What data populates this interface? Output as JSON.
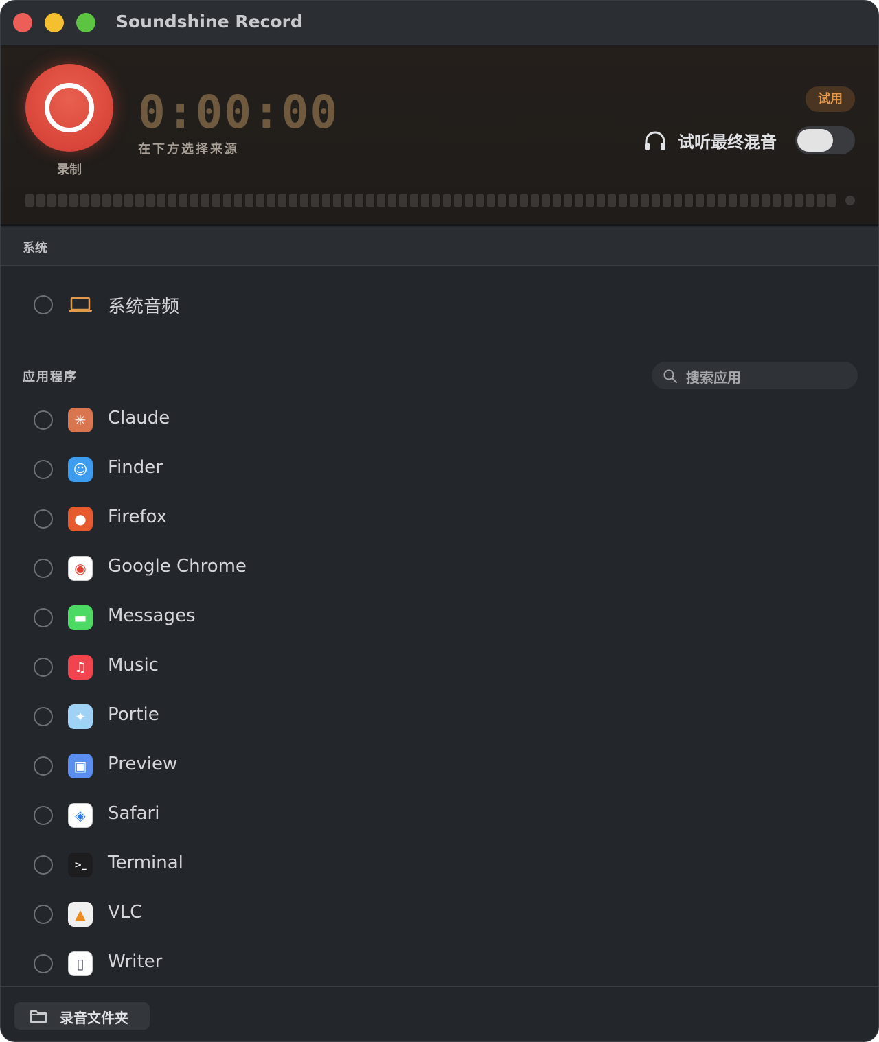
{
  "window": {
    "title": "Soundshine Record"
  },
  "recorder": {
    "record_label": "录制",
    "timer": "0:00:00",
    "timer_hint": "在下方选择来源",
    "trial_badge": "试用",
    "monitor_label": "试听最终混音",
    "monitor_enabled": false
  },
  "system": {
    "header": "系统",
    "source": {
      "label": "系统音频",
      "icon": "laptop-icon",
      "selected": false
    }
  },
  "apps": {
    "header": "应用程序",
    "search_placeholder": "搜索应用",
    "items": [
      {
        "label": "Claude",
        "icon": "claude-icon",
        "color": "#d9764f"
      },
      {
        "label": "Finder",
        "icon": "finder-icon",
        "color": "#3c9cf0"
      },
      {
        "label": "Firefox",
        "icon": "firefox-icon",
        "color": "#e55b2d"
      },
      {
        "label": "Google Chrome",
        "icon": "chrome-icon",
        "color": "#ffffff"
      },
      {
        "label": "Messages",
        "icon": "messages-icon",
        "color": "#4cd964"
      },
      {
        "label": "Music",
        "icon": "music-icon",
        "color": "#f2444f"
      },
      {
        "label": "Portie",
        "icon": "portie-icon",
        "color": "#9fd2f5"
      },
      {
        "label": "Preview",
        "icon": "preview-icon",
        "color": "#5a8ff0"
      },
      {
        "label": "Safari",
        "icon": "safari-icon",
        "color": "#ffffff"
      },
      {
        "label": "Terminal",
        "icon": "terminal-icon",
        "color": "#1d1d1f"
      },
      {
        "label": "VLC",
        "icon": "vlc-icon",
        "color": "#f0f0f0"
      },
      {
        "label": "Writer",
        "icon": "writer-icon",
        "color": "#ffffff"
      }
    ]
  },
  "footer": {
    "folder_button": "录音文件夹"
  },
  "colors": {
    "accent": "#d9453a",
    "trial": "#e49a4c",
    "background": "#23262b"
  }
}
